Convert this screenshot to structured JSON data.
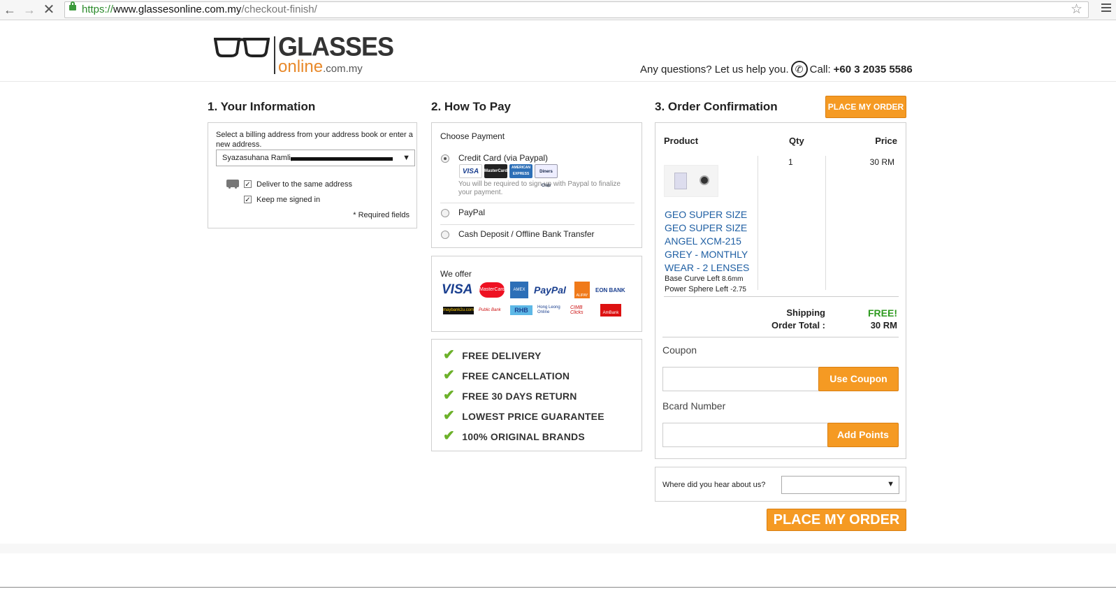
{
  "browser": {
    "url_scheme": "https://",
    "url_host": "www.glassesonline.com.my",
    "url_path": "/checkout-finish/"
  },
  "header": {
    "logo_main": "GLASSES",
    "logo_sub": "online",
    "logo_domain": ".com.my",
    "help_text": "Any questions? Let us help you.",
    "call_label": "Call:",
    "phone": "+60 3 2035 5586"
  },
  "info": {
    "title": "1. Your Information",
    "billing_prompt": "Select a billing address from your address book or enter a new address.",
    "address_value": "Syazasuhana Ramli, ",
    "deliver_same": "Deliver to the same address",
    "keep_signed": "Keep me signed in",
    "required": "* Required fields"
  },
  "pay": {
    "title": "2. How To Pay",
    "choose": "Choose Payment",
    "options": [
      {
        "label": "Credit Card (via Paypal)",
        "selected": true
      },
      {
        "label": "PayPal",
        "selected": false
      },
      {
        "label": "Cash Deposit / Offline Bank Transfer",
        "selected": false
      }
    ],
    "cc_cards": [
      "VISA",
      "MasterCard",
      "AMERICAN EXPRESS",
      "Diners Club"
    ],
    "cc_note": "You will be required to sign up with Paypal to finalize your payment.",
    "we_offer": "We offer",
    "offer_row1": [
      "VISA",
      "MasterCard",
      "AMEX",
      "PayPal",
      "ALIPAY",
      "EON BANK"
    ],
    "offer_row2": [
      "maybank2u.com",
      "Public Bank",
      "RHB",
      "Hong Leong Online",
      "CIMB Clicks",
      "AmBank"
    ],
    "features": [
      "FREE DELIVERY",
      "FREE CANCELLATION",
      "FREE 30 DAYS RETURN",
      "LOWEST PRICE GUARANTEE",
      "100% ORIGINAL BRANDS"
    ]
  },
  "order": {
    "title": "3. Order Confirmation",
    "place_btn_small": "PLACE MY ORDER",
    "col_product": "Product",
    "col_qty": "Qty",
    "col_price": "Price",
    "qty": "1",
    "price": "30 RM",
    "product_name": "GEO SUPER SIZE GEO SUPER SIZE ANGEL XCM-215 GREY - MONTHLY WEAR - 2 LENSES",
    "product_lines": [
      "GEO SUPER SIZE",
      "GEO SUPER SIZE",
      "ANGEL XCM-215",
      "GREY - MONTHLY",
      "WEAR - 2 LENSES"
    ],
    "base_curve_label": "Base Curve Left",
    "base_curve_value": "8.6mm",
    "power_label": "Power Sphere Left",
    "power_value": "-2.75",
    "shipping_label": "Shipping",
    "shipping_value": "FREE!",
    "total_label": "Order Total :",
    "total_value": "30 RM",
    "coupon_label": "Coupon",
    "coupon_btn": "Use Coupon",
    "bcard_label": "Bcard Number",
    "bcard_btn": "Add Points",
    "hear_label": "Where did you hear about us?",
    "place_btn_big": "PLACE MY ORDER"
  },
  "colors": {
    "orange": "#f59a23",
    "link_blue": "#1f5fa3",
    "free_green": "#2e9a1f"
  }
}
